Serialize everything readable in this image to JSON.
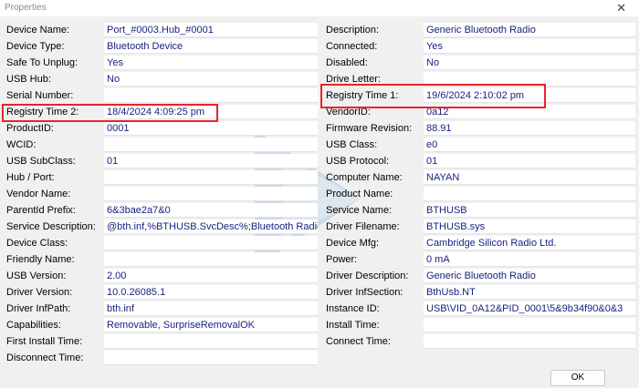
{
  "window": {
    "title": "Properties",
    "close_glyph": "✕"
  },
  "left": [
    {
      "label": "Device Name:",
      "value": "Port_#0003.Hub_#0001"
    },
    {
      "label": "Device Type:",
      "value": "Bluetooth Device"
    },
    {
      "label": "Safe To Unplug:",
      "value": "Yes"
    },
    {
      "label": "USB Hub:",
      "value": "No"
    },
    {
      "label": "Serial Number:",
      "value": ""
    },
    {
      "label": "Registry Time 2:",
      "value": "18/4/2024 4:09:25 pm"
    },
    {
      "label": "ProductID:",
      "value": "0001"
    },
    {
      "label": "WCID:",
      "value": ""
    },
    {
      "label": "USB SubClass:",
      "value": "01"
    },
    {
      "label": "Hub / Port:",
      "value": ""
    },
    {
      "label": "Vendor Name:",
      "value": ""
    },
    {
      "label": "ParentId Prefix:",
      "value": "6&3bae2a7&0"
    },
    {
      "label": "Service Description:",
      "value": "@bth.inf,%BTHUSB.SvcDesc%;Bluetooth Radio"
    },
    {
      "label": "Device Class:",
      "value": ""
    },
    {
      "label": "Friendly Name:",
      "value": ""
    },
    {
      "label": "USB Version:",
      "value": "2.00"
    },
    {
      "label": "Driver Version:",
      "value": "10.0.26085.1"
    },
    {
      "label": "Driver InfPath:",
      "value": "bth.inf"
    },
    {
      "label": "Capabilities:",
      "value": "Removable, SurpriseRemovalOK"
    },
    {
      "label": "First Install Time:",
      "value": ""
    },
    {
      "label": "Disconnect Time:",
      "value": ""
    }
  ],
  "right": [
    {
      "label": "Description:",
      "value": "Generic Bluetooth Radio"
    },
    {
      "label": "Connected:",
      "value": "Yes"
    },
    {
      "label": "Disabled:",
      "value": "No"
    },
    {
      "label": "Drive Letter:",
      "value": ""
    },
    {
      "label": "Registry Time 1:",
      "value": "19/6/2024 2:10:02 pm"
    },
    {
      "label": "VendorID:",
      "value": "0a12"
    },
    {
      "label": "Firmware Revision:",
      "value": "88.91"
    },
    {
      "label": "USB Class:",
      "value": "e0"
    },
    {
      "label": "USB Protocol:",
      "value": "01"
    },
    {
      "label": "Computer Name:",
      "value": "NAYAN"
    },
    {
      "label": "Product Name:",
      "value": ""
    },
    {
      "label": "Service Name:",
      "value": "BTHUSB"
    },
    {
      "label": "Driver Filename:",
      "value": "BTHUSB.sys"
    },
    {
      "label": "Device Mfg:",
      "value": "Cambridge Silicon Radio Ltd."
    },
    {
      "label": "Power:",
      "value": "0 mA"
    },
    {
      "label": "Driver Description:",
      "value": "Generic Bluetooth Radio"
    },
    {
      "label": "Driver InfSection:",
      "value": "BthUsb.NT"
    },
    {
      "label": "Instance ID:",
      "value": "USB\\VID_0A12&PID_0001\\5&9b34f90&0&3"
    },
    {
      "label": "Install Time:",
      "value": ""
    },
    {
      "label": "Connect Time:",
      "value": ""
    }
  ],
  "buttons": {
    "ok_label": "OK"
  },
  "colors": {
    "value_text": "#1a237e",
    "highlight": "#e8242a",
    "watermark": "#4a90d9"
  }
}
